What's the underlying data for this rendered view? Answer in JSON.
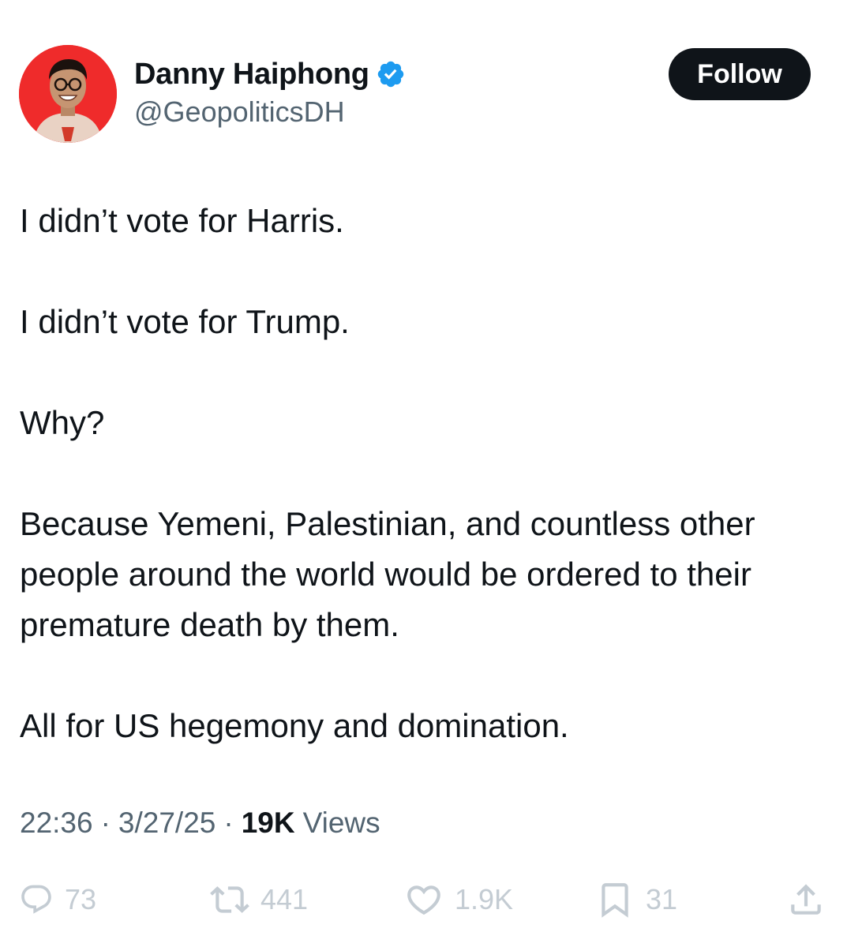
{
  "tweet": {
    "author": {
      "display_name": "Danny Haiphong",
      "handle": "@GeopoliticsDH",
      "verified": true,
      "avatar_bg": "#ef2b2b"
    },
    "follow_label": "Follow",
    "text_paragraphs": [
      "I didn’t vote for Harris.",
      "I didn’t vote for Trump.",
      "Why?",
      "Because Yemeni, Palestinian, and countless other people around the world would be ordered to their premature death by them.",
      "All for US hegemony and domination."
    ],
    "time": "22:36",
    "separator": "·",
    "date": "3/27/25",
    "views_count": "19K",
    "views_label": "Views",
    "actions": {
      "replies": "73",
      "reposts": "441",
      "likes": "1.9K",
      "bookmarks": "31"
    },
    "icons": [
      "verified-badge-icon",
      "reply-icon",
      "repost-icon",
      "like-icon",
      "bookmark-icon",
      "share-icon"
    ],
    "colors": {
      "follow_button": "#0f1419",
      "verified": "#1d9bf0",
      "secondary_text": "#536471",
      "action_icons": "#c4ccd3"
    }
  }
}
